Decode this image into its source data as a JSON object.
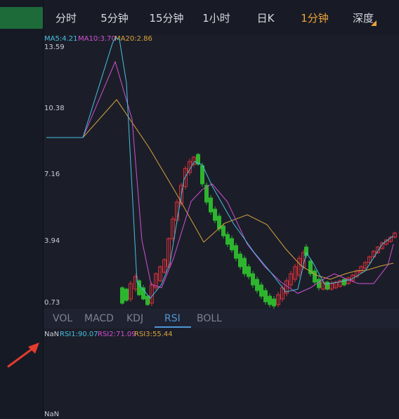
{
  "tabs": [
    "分时",
    "5分钟",
    "15分钟",
    "1小时",
    "日K",
    "1分钟",
    "深度"
  ],
  "active_tab": "1分钟",
  "ma_labels": [
    {
      "text": "MA5:4.21",
      "color": "#46c0e0"
    },
    {
      "text": "MA10:3.70",
      "color": "#d24fd6"
    },
    {
      "text": "MA20:2.86",
      "color": "#d9a23c"
    }
  ],
  "y_labels": [
    "13.59",
    "10.38",
    "7.16",
    "3.94",
    "0.73"
  ],
  "indicator_tabs": [
    "VOL",
    "MACD",
    "KDJ",
    "RSI",
    "BOLL"
  ],
  "active_indicator": "RSI",
  "rsi_labels": [
    {
      "text": "NaN",
      "color": "#c9ccd6"
    },
    {
      "text": "RSI1:90.07",
      "color": "#46c0e0"
    },
    {
      "text": "RSI2:71.09",
      "color": "#d24fd6"
    },
    {
      "text": "RSI3:55.44",
      "color": "#d9a23c"
    }
  ],
  "rsi_bottom": "NaN",
  "colors": {
    "up": "#d6303a",
    "down": "#2eb52e",
    "accent": "#f0a43a",
    "rsi_active": "#4e97d6"
  },
  "annotation_arrow_color": "#e33b2e"
}
